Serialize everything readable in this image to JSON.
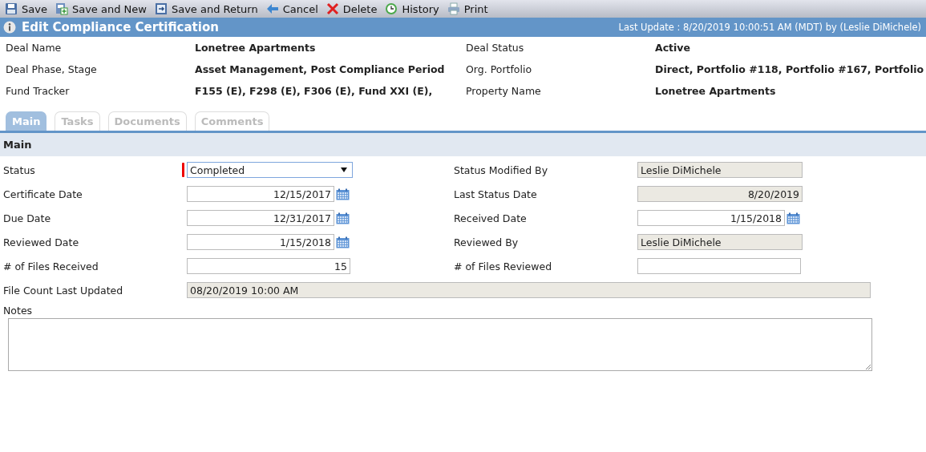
{
  "toolbar": {
    "buttons": [
      "Save",
      "Save and New",
      "Save and Return",
      "Cancel",
      "Delete",
      "History",
      "Print"
    ]
  },
  "header": {
    "title": "Edit Compliance Certification",
    "last_update": "Last Update : 8/20/2019 10:00:51 AM (MDT) by (Leslie DiMichele)"
  },
  "deal_info": [
    {
      "label": "Deal Name",
      "value": "Lonetree Apartments"
    },
    {
      "label": "Deal Status",
      "value": "Active"
    },
    {
      "label": "Deal Phase, Stage",
      "value": "Asset Management, Post Compliance Period"
    },
    {
      "label": "Org. Portfolio",
      "value": "Direct, Portfolio #118, Portfolio #167, Portfolio"
    },
    {
      "label": "Fund Tracker",
      "value": "F155 (E), F298 (E), F306 (E), Fund XXI (E),"
    },
    {
      "label": "Property Name",
      "value": "Lonetree Apartments"
    }
  ],
  "tabs": [
    {
      "label": "Main",
      "selected": true
    },
    {
      "label": "Tasks",
      "selected": false
    },
    {
      "label": "Documents",
      "selected": false
    },
    {
      "label": "Comments",
      "selected": false
    }
  ],
  "section": {
    "title": "Main"
  },
  "form": {
    "rows": [
      [
        {
          "kind": "select",
          "label": "Status",
          "value": "Completed",
          "required": true
        },
        {
          "kind": "readonly",
          "label": "Status Modified By",
          "value": "Leslie DiMichele",
          "required": false
        }
      ],
      [
        {
          "kind": "date",
          "label": "Certificate Date",
          "value": "12/15/2017",
          "required": false
        },
        {
          "kind": "readonly_number",
          "label": "Last Status Date",
          "value": "8/20/2019",
          "required": false
        }
      ],
      [
        {
          "kind": "date",
          "label": "Due Date",
          "value": "12/31/2017",
          "required": false
        },
        {
          "kind": "date",
          "label": "Received Date",
          "value": "1/15/2018",
          "required": false
        }
      ],
      [
        {
          "kind": "date",
          "label": "Reviewed Date",
          "value": "1/15/2018",
          "required": false
        },
        {
          "kind": "readonly",
          "label": "Reviewed By",
          "value": "Leslie DiMichele",
          "required": false
        }
      ],
      [
        {
          "kind": "number",
          "label": "# of Files Received",
          "value": "15",
          "required": false
        },
        {
          "kind": "number",
          "label": "# of Files Reviewed",
          "required": false
        }
      ],
      [
        {
          "kind": "readonly",
          "label": "File Count Last Updated",
          "value": "08/20/2019 10:00 AM",
          "required": false
        }
      ]
    ]
  },
  "notes": {
    "label": "Notes"
  }
}
